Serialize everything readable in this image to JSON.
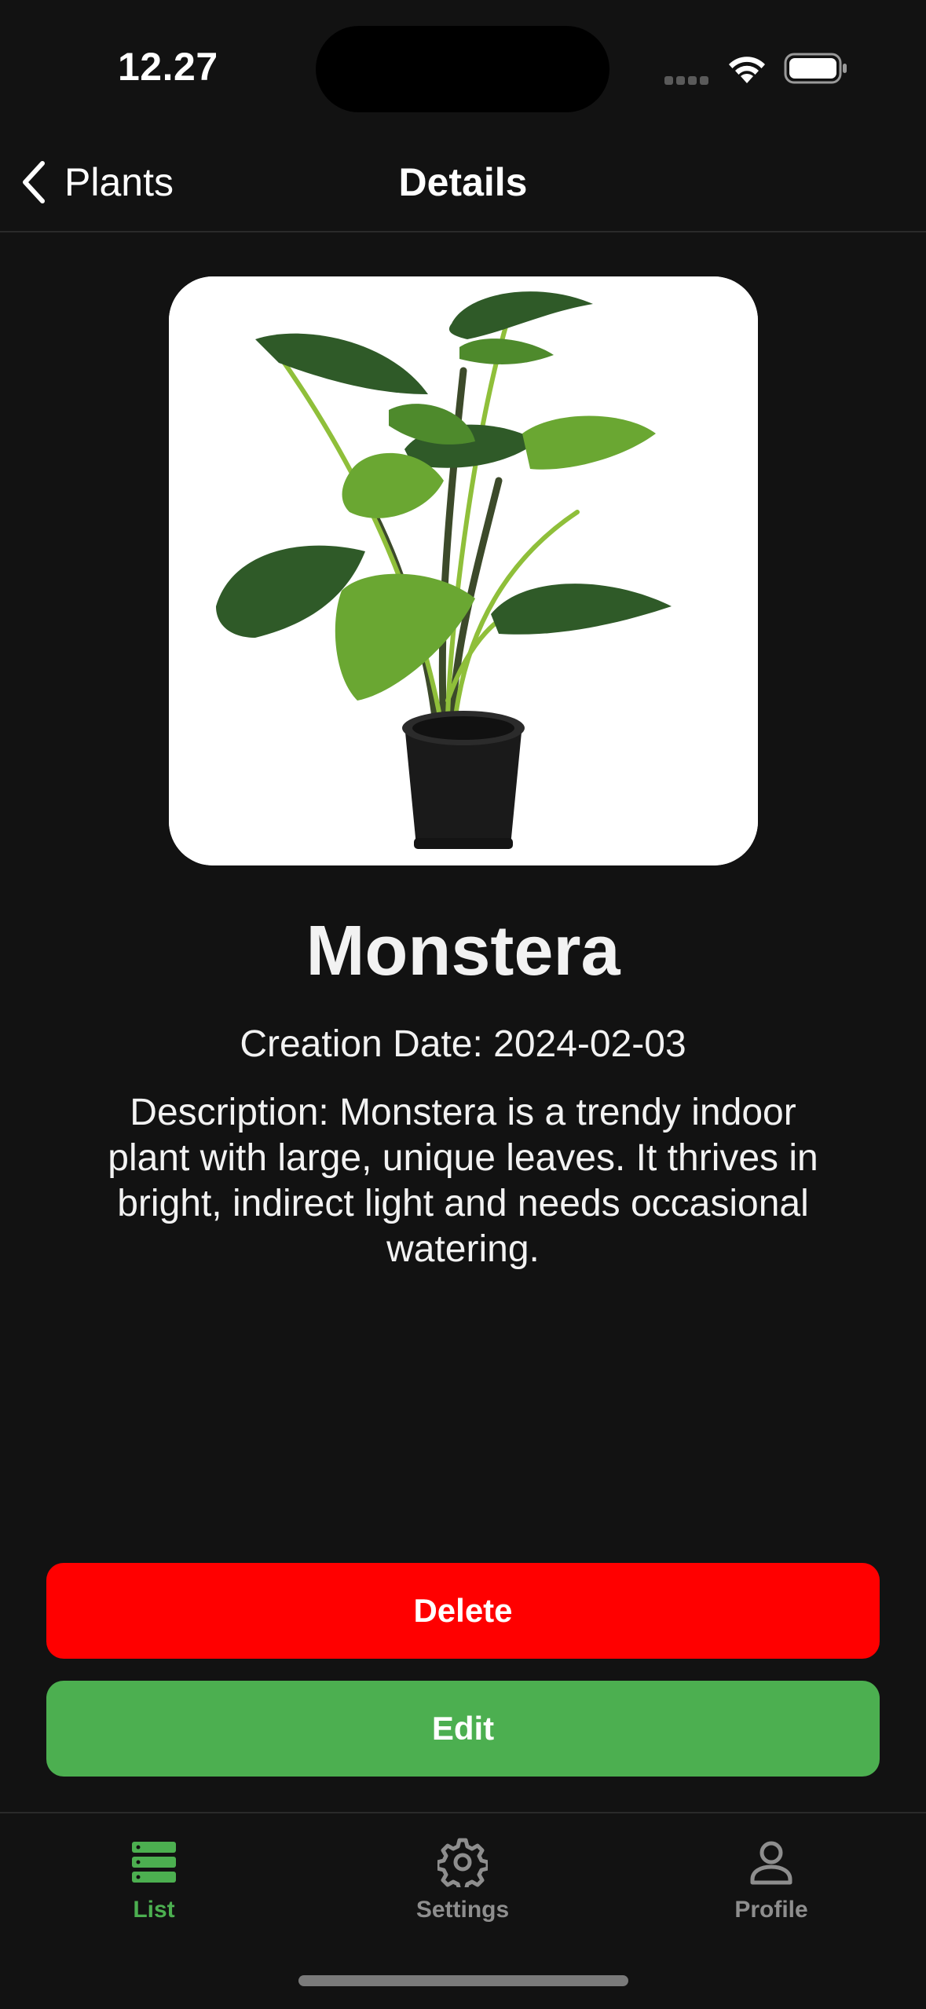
{
  "status_bar": {
    "time": "12.27"
  },
  "nav": {
    "back_label": "Plants",
    "title": "Details"
  },
  "plant": {
    "name": "Monstera",
    "creation_date": "Creation Date: 2024-02-03",
    "description": "Description: Monstera is a trendy indoor plant with large, unique leaves. It thrives in bright, indirect light and needs occasional watering."
  },
  "actions": {
    "delete_label": "Delete",
    "edit_label": "Edit"
  },
  "tabs": [
    {
      "label": "List",
      "icon": "list-icon",
      "active": true
    },
    {
      "label": "Settings",
      "icon": "gear-icon",
      "active": false
    },
    {
      "label": "Profile",
      "icon": "person-icon",
      "active": false
    }
  ],
  "colors": {
    "background": "#121212",
    "accent_green": "#4caf50",
    "delete_red": "#ff0000",
    "inactive_tab": "#8e8e8e"
  }
}
